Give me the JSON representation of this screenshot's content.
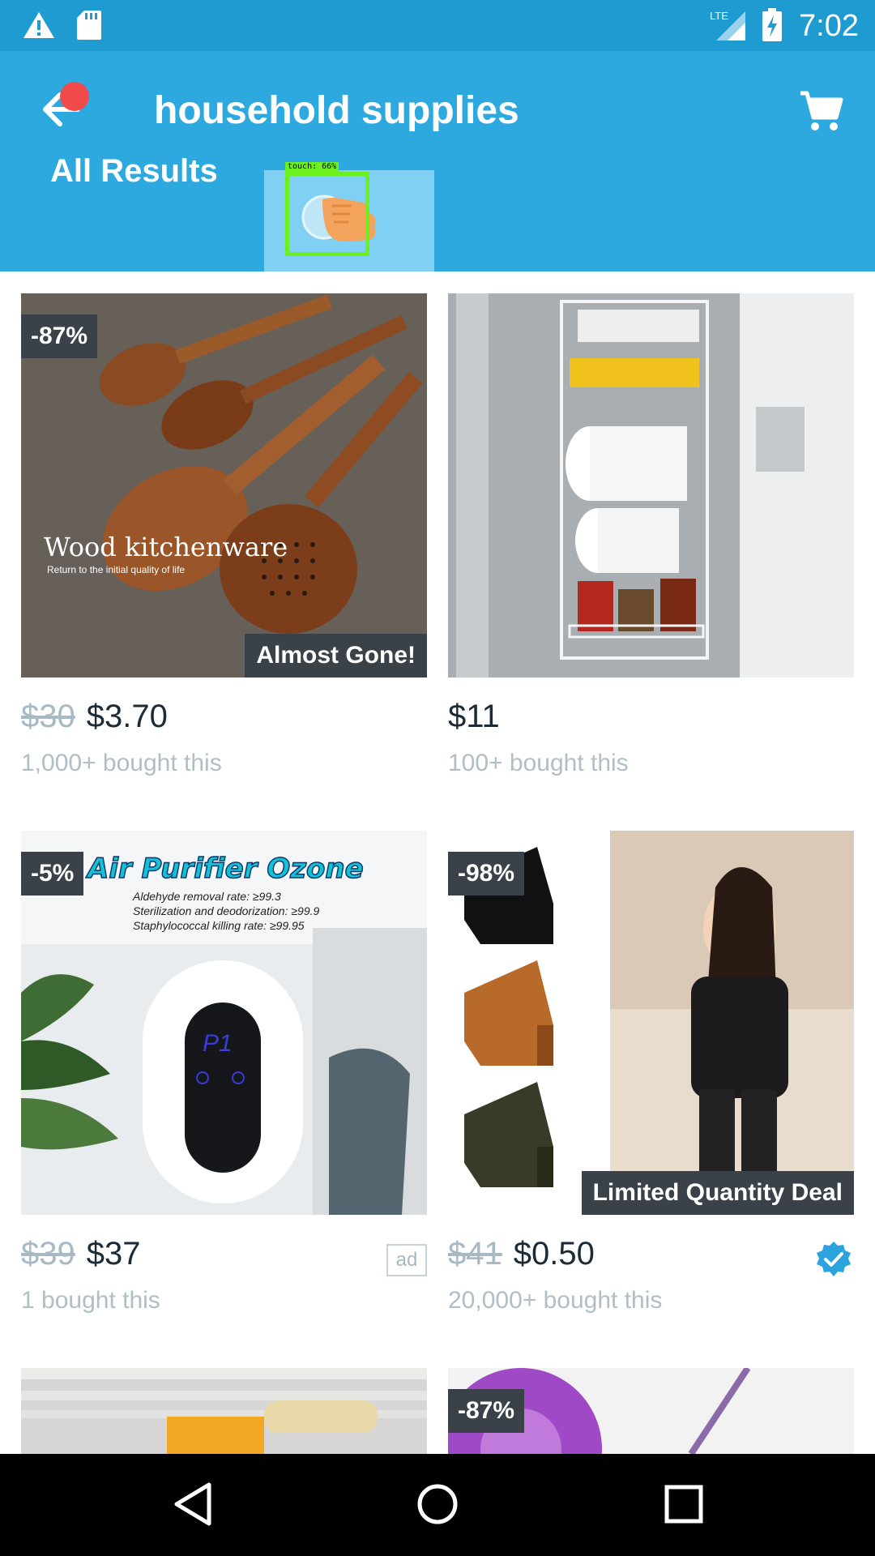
{
  "status_bar": {
    "time": "7:02",
    "network_label": "LTE",
    "icons": [
      "warning-icon",
      "sd-card-icon",
      "lte-signal-icon",
      "battery-charging-icon"
    ]
  },
  "header": {
    "title": "household supplies",
    "back_icon": "arrow-left-icon",
    "cart_icon": "shopping-cart-icon"
  },
  "tabs": {
    "all_results": "All Results",
    "gesture_label": "touch: 66%",
    "gesture_icon": "pointing-hand-icon"
  },
  "products": [
    {
      "image_caption": "Wood kitchenware",
      "image_subcaption": "Return to the initial quality of life",
      "discount": "-87%",
      "banner": "Almost Gone!",
      "old_price": "$30",
      "price": "$3.70",
      "bought": "1,000+ bought this"
    },
    {
      "discount": "",
      "banner": "",
      "old_price": "",
      "price": "$11",
      "bought": "100+ bought this"
    },
    {
      "image_caption": "Air Purifier Ozone",
      "image_lines": [
        "Aldehyde removal rate: ≥99.3",
        "Sterilization and deodorization: ≥99.9",
        "Staphylococcal killing rate: ≥99.95"
      ],
      "display_reading": "P1",
      "discount": "-5%",
      "old_price": "$39",
      "price": "$37",
      "bought": "1 bought this",
      "ad_label": "ad"
    },
    {
      "discount": "-98%",
      "banner": "Limited Quantity Deal",
      "old_price": "$41",
      "price": "$0.50",
      "bought": "20,000+ bought this",
      "verified_icon": "check-badge-icon"
    },
    {
      "discount": ""
    },
    {
      "discount": "-87%"
    }
  ],
  "colors": {
    "status_bar": "#1e9bd1",
    "app_bar": "#2ea9e0",
    "badge": "#3a4148",
    "price": "#1c2b36",
    "muted": "#b0bec5"
  },
  "nav_bar": {
    "icons": [
      "nav-back-icon",
      "nav-home-icon",
      "nav-recents-icon"
    ]
  }
}
